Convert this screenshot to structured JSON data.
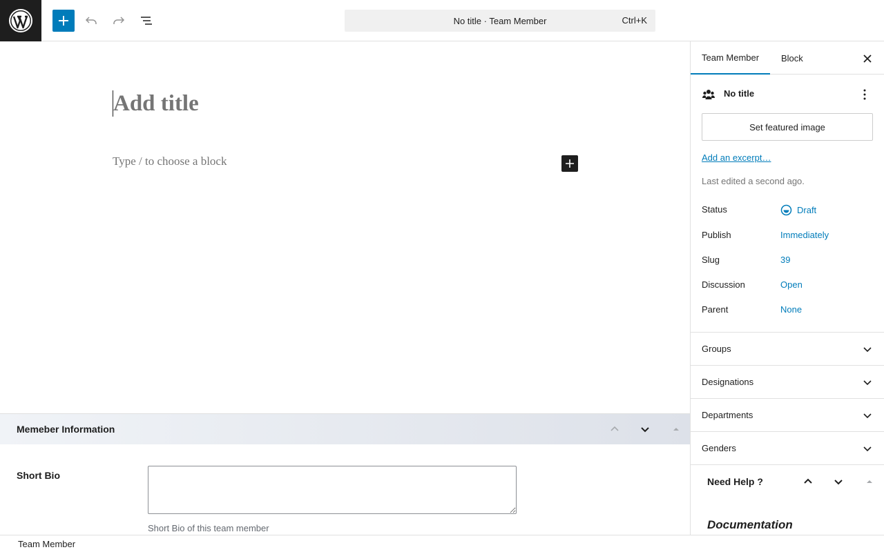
{
  "topbar": {
    "command_title": "No title · Team Member",
    "command_shortcut": "Ctrl+K"
  },
  "editor": {
    "title_placeholder": "Add title",
    "block_placeholder": "Type / to choose a block"
  },
  "metabox": {
    "title": "Memeber Information",
    "short_bio_label": "Short Bio",
    "short_bio_value": "",
    "short_bio_help": "Short Bio of this team member"
  },
  "footer": {
    "breadcrumb": "Team Member"
  },
  "sidebar": {
    "tabs": [
      {
        "label": "Team Member",
        "active": true
      },
      {
        "label": "Block",
        "active": false
      }
    ],
    "post_title": "No title",
    "featured_image_label": "Set featured image",
    "excerpt_link": "Add an excerpt…",
    "last_edited": "Last edited a second ago.",
    "properties": [
      {
        "key": "Status",
        "value": "Draft"
      },
      {
        "key": "Publish",
        "value": "Immediately"
      },
      {
        "key": "Slug",
        "value": "39"
      },
      {
        "key": "Discussion",
        "value": "Open"
      },
      {
        "key": "Parent",
        "value": "None"
      }
    ],
    "panels": [
      {
        "title": "Groups"
      },
      {
        "title": "Designations"
      },
      {
        "title": "Departments"
      },
      {
        "title": "Genders"
      }
    ],
    "help": {
      "title": "Need Help ?",
      "documentation": "Documentation"
    }
  },
  "colors": {
    "accent": "#007cba",
    "dark": "#1e1e1e",
    "muted": "#757575"
  },
  "icons": [
    "wordpress-logo-icon",
    "plus-icon",
    "undo-icon",
    "redo-icon",
    "document-overview-icon",
    "close-icon",
    "team-icon",
    "more-vertical-icon",
    "draft-status-icon",
    "chevron-up-icon",
    "chevron-down-icon",
    "triangle-up-icon"
  ]
}
